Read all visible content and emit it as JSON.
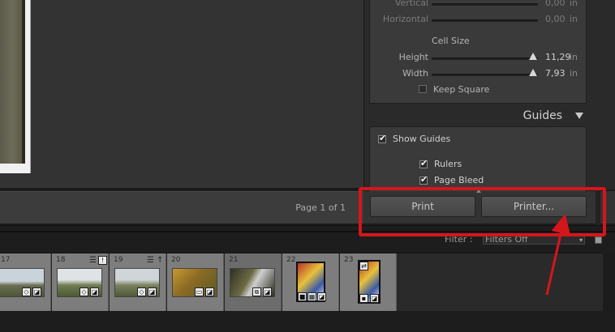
{
  "layout": {
    "rows": [
      {
        "label": "Vertical",
        "value": "0,00",
        "unit": "in",
        "dim": true
      },
      {
        "label": "Horizontal",
        "value": "0,00",
        "unit": "in",
        "dim": true
      }
    ],
    "cell_size_title": "Cell Size",
    "cell_rows": [
      {
        "label": "Height",
        "value": "11,29",
        "unit": "in"
      },
      {
        "label": "Width",
        "value": "7,93",
        "unit": "in"
      }
    ],
    "keep_square_label": "Keep Square",
    "keep_square_checked": false
  },
  "guides": {
    "title": "Guides",
    "show_guides_label": "Show Guides",
    "rulers_label": "Rulers",
    "page_bleed_label": "Page Bleed"
  },
  "bottom_bar": {
    "page_count": "Page 1 of 1"
  },
  "print_buttons": {
    "print_label": "Print",
    "printer_label": "Printer..."
  },
  "filter": {
    "label": "Filter :",
    "value": "Filters Off"
  },
  "filmstrip": {
    "cells": [
      {
        "number": "17"
      },
      {
        "number": "18"
      },
      {
        "number": "19"
      },
      {
        "number": "20"
      },
      {
        "number": "21"
      },
      {
        "number": "22"
      },
      {
        "number": "23"
      }
    ]
  },
  "colors": {
    "annotation": "#d4161c",
    "panel_bg": "#3a3a3a",
    "app_bg": "#1c1c1c"
  }
}
